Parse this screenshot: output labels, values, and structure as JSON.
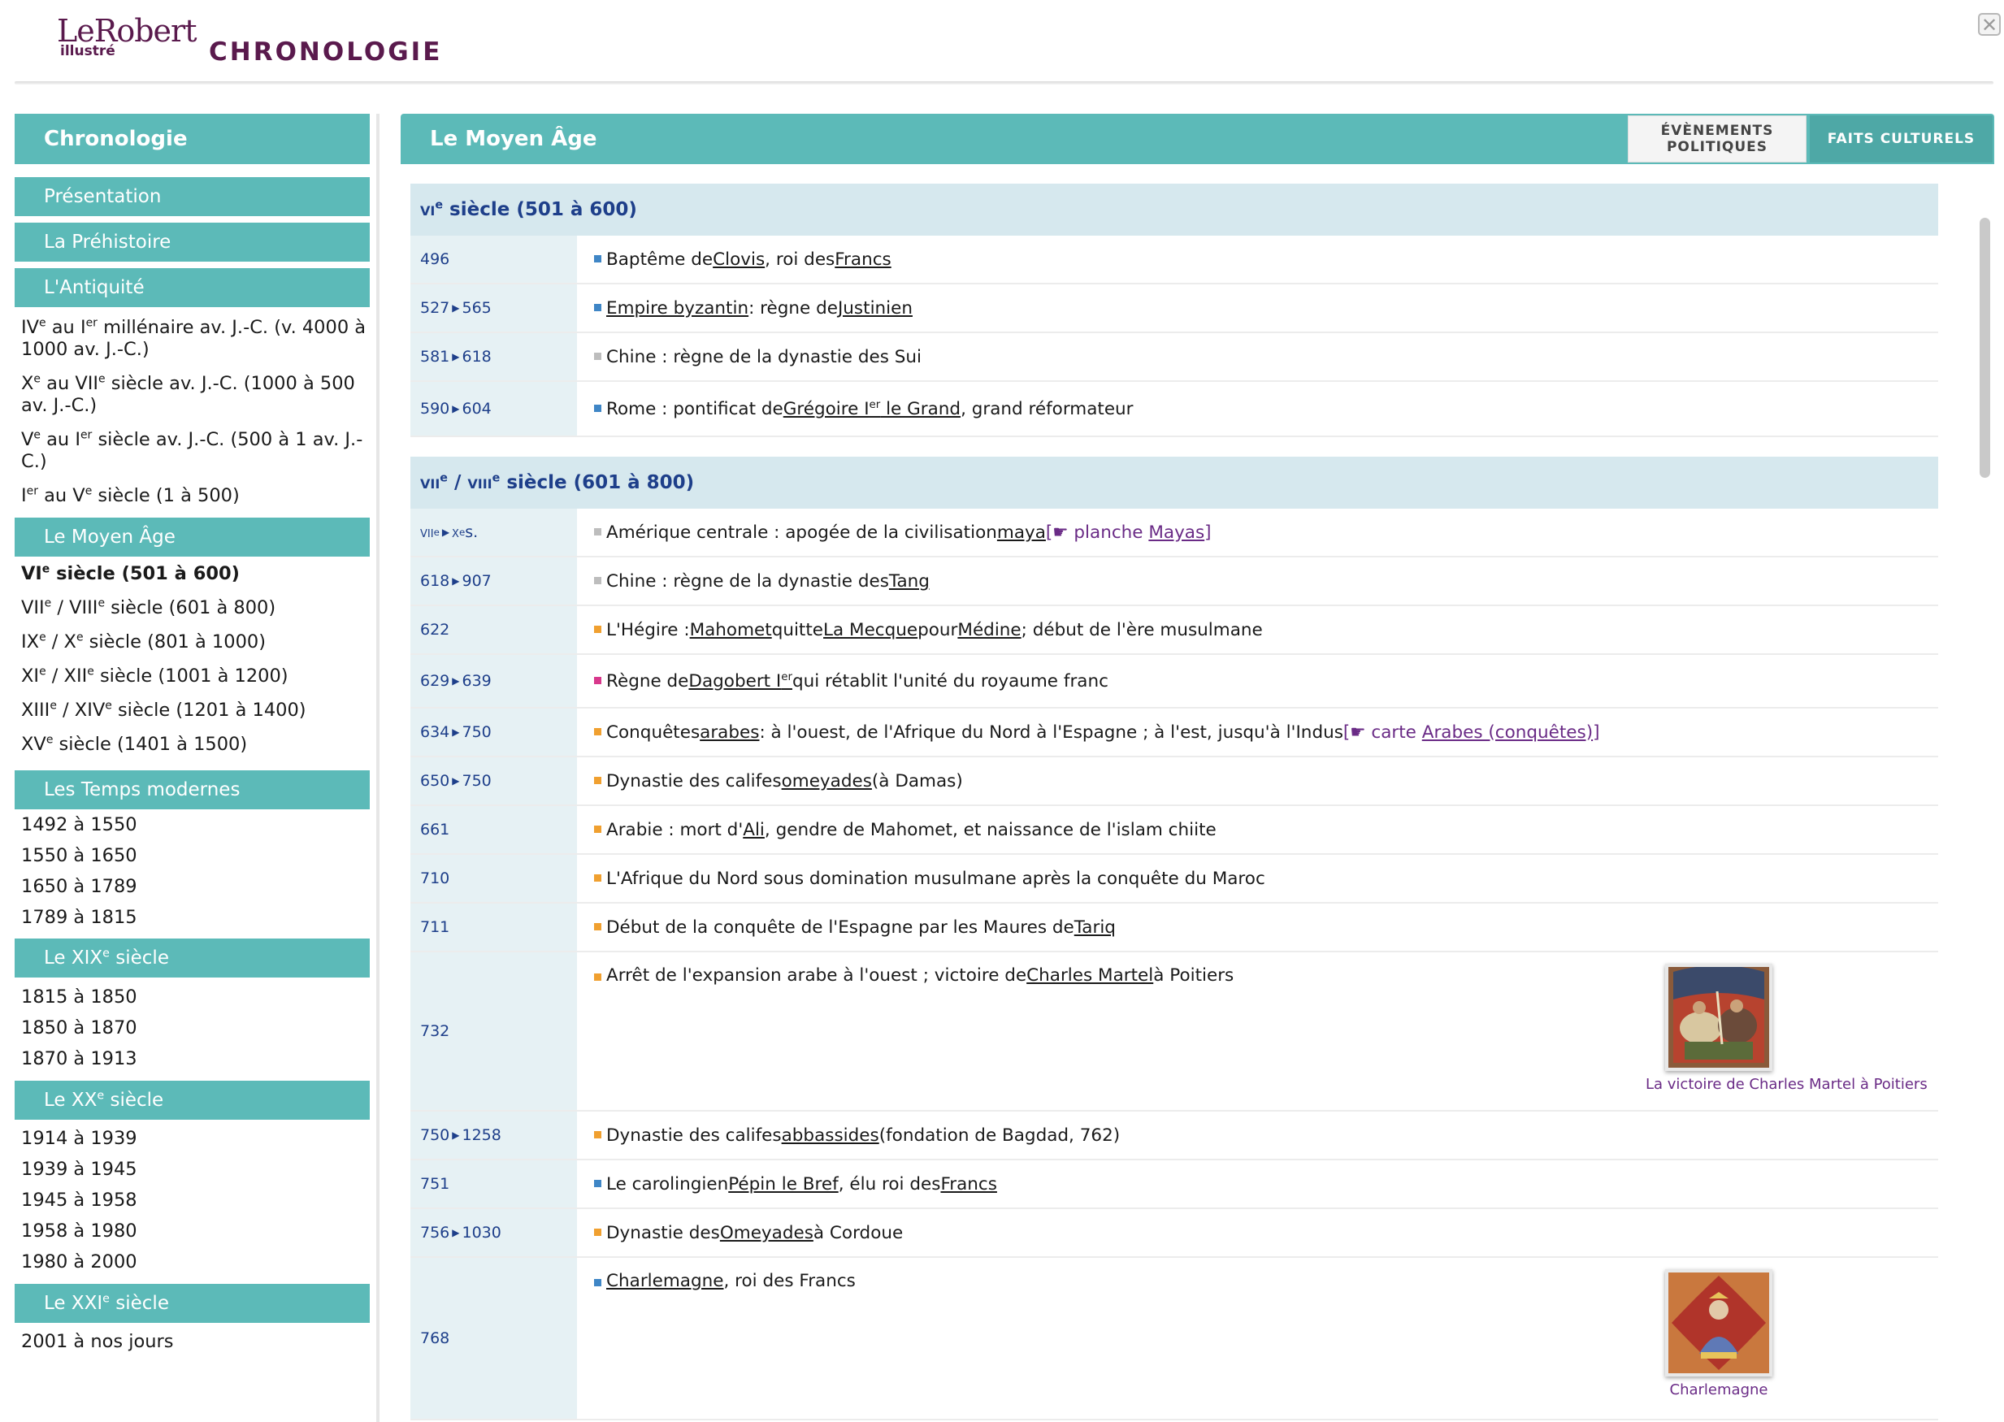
{
  "header": {
    "logo_main": "LeRobert",
    "logo_sub": "illustré",
    "app_title": "CHRONOLOGIE",
    "close_label": "✕"
  },
  "sidebar": {
    "title": "Chronologie",
    "items": {
      "presentation": "Présentation",
      "prehistoire": "La Préhistoire",
      "antiquite": "L'Antiquité",
      "ant1_a": "IV",
      "ant1_b": "e",
      "ant1_c": " au I",
      "ant1_d": "er",
      "ant1_e": " millénaire av. J.-C. (v. 4000 à 1000 av. J.-C.)",
      "ant2_a": "X",
      "ant2_b": "e",
      "ant2_c": " au VII",
      "ant2_d": "e",
      "ant2_e": " siècle av. J.-C. (1000 à 500 av. J.-C.)",
      "ant3_a": "V",
      "ant3_b": "e",
      "ant3_c": " au I",
      "ant3_d": "er",
      "ant3_e": " siècle av. J.-C. (500 à 1 av. J.-C.)",
      "ant4_a": "I",
      "ant4_b": "er",
      "ant4_c": " au V",
      "ant4_d": "e",
      "ant4_e": " siècle (1 à 500)",
      "moyen_age": "Le Moyen Âge",
      "ma1_a": "VI",
      "ma1_b": "e",
      "ma1_c": " siècle (501 à 600)",
      "ma2_a": "VII",
      "ma2_b": "e",
      "ma2_c": " / VIII",
      "ma2_d": "e",
      "ma2_e": " siècle (601 à 800)",
      "ma3_a": "IX",
      "ma3_b": "e",
      "ma3_c": " / X",
      "ma3_d": "e",
      "ma3_e": " siècle (801 à 1000)",
      "ma4_a": "XI",
      "ma4_b": "e",
      "ma4_c": " / XII",
      "ma4_d": "e",
      "ma4_e": " siècle (1001 à 1200)",
      "ma5_a": "XIII",
      "ma5_b": "e",
      "ma5_c": " / XIV",
      "ma5_d": "e",
      "ma5_e": " siècle (1201 à 1400)",
      "ma6_a": "XV",
      "ma6_b": "e",
      "ma6_c": " siècle (1401 à 1500)",
      "temps_modernes": "Les Temps modernes",
      "tm1": "1492 à 1550",
      "tm2": "1550 à 1650",
      "tm3": "1650 à 1789",
      "tm4": "1789 à 1815",
      "xix_a": "Le XIX",
      "xix_b": "e",
      "xix_c": " siècle",
      "x19_1": "1815 à 1850",
      "x19_2": "1850 à 1870",
      "x19_3": "1870 à 1913",
      "xx_a": "Le XX",
      "xx_b": "e",
      "xx_c": " siècle",
      "x20_1": "1914 à 1939",
      "x20_2": "1939 à 1945",
      "x20_3": "1945 à 1958",
      "x20_4": "1958 à 1980",
      "x20_5": "1980 à 2000",
      "xxi_a": "Le XXI",
      "xxi_b": "e",
      "xxi_c": " siècle",
      "x21_1": "2001 à nos jours"
    }
  },
  "main": {
    "title": "Le Moyen Âge",
    "tab_political": "Évènements politiques",
    "tab_cultural": "Faits culturels",
    "sec1": {
      "a": "vi",
      "b": "e",
      "c": " siècle (501 à 600)"
    },
    "sec2": {
      "a": "vii",
      "b": "e",
      "c": " / ",
      "d": "viii",
      "e": "e",
      "f": " siècle (601 à 800)"
    },
    "arrow": "▶",
    "rows": {
      "r1": {
        "date": "496",
        "t1": "Baptême de ",
        "l1": "Clovis",
        "t2": ", roi des ",
        "l2": "Francs"
      },
      "r2": {
        "d1": "527",
        "d2": "565",
        "l1": "Empire byzantin",
        "t1": " : règne de ",
        "l2": "Justinien"
      },
      "r3": {
        "d1": "581",
        "d2": "618",
        "t1": "Chine : règne de la dynastie des Sui"
      },
      "r4": {
        "d1": "590",
        "d2": "604",
        "t1": "Rome : pontificat de ",
        "l1a": "Grégoire I",
        "l1b": "er",
        "l1c": " le Grand",
        "t2": ", grand réformateur"
      },
      "r5": {
        "d1a": "vii",
        "d1b": "e",
        "d2a": "x",
        "d2b": "e",
        "d2c": " s.",
        "t1": "Amérique centrale : apogée de la civilisation ",
        "l1": "maya",
        "t2": " ",
        "ref1": "[☛ planche ",
        "ref2": "Mayas",
        "ref3": "]"
      },
      "r6": {
        "d1": "618",
        "d2": "907",
        "t1": "Chine : règne de la dynastie des ",
        "l1": "Tang"
      },
      "r7": {
        "date": "622",
        "t1": "L'Hégire : ",
        "l1": "Mahomet",
        "t2": " quitte ",
        "l2": "La Mecque",
        "t3": " pour ",
        "l3": "Médine",
        "t4": " ; début de l'ère musulmane"
      },
      "r8": {
        "d1": "629",
        "d2": "639",
        "t1": "Règne de ",
        "l1a": "Dagobert I",
        "l1b": "er",
        "t2": " qui rétablit l'unité du royaume franc"
      },
      "r9": {
        "d1": "634",
        "d2": "750",
        "t1": "Conquêtes ",
        "l1": "arabes",
        "t2": " : à l'ouest, de l'Afrique du Nord à l'Espagne ; à l'est, jusqu'à l'Indus ",
        "ref1": "[☛ carte ",
        "ref2": "Arabes (conquêtes)",
        "ref3": "]"
      },
      "r10": {
        "d1": "650",
        "d2": "750",
        "t1": "Dynastie des califes ",
        "l1": "omeyades",
        "t2": " (à Damas)"
      },
      "r11": {
        "date": "661",
        "t1": "Arabie : mort d'",
        "l1": "Ali",
        "t2": ", gendre de Mahomet, et naissance de l'islam chiite"
      },
      "r12": {
        "date": "710",
        "t1": "L'Afrique du Nord sous domination musulmane après la conquête du Maroc"
      },
      "r13": {
        "date": "711",
        "t1": "Début de la conquête de l'Espagne par les Maures de ",
        "l1": "Tariq"
      },
      "r14": {
        "date": "732",
        "t1": "Arrêt de l'expansion arabe à l'ouest ; victoire de ",
        "l1": "Charles Martel",
        "t2": " à Poitiers",
        "caption": "La victoire de Charles Martel à Poitiers"
      },
      "r15": {
        "d1": "750",
        "d2": "1258",
        "t1": "Dynastie des califes ",
        "l1": "abbassides",
        "t2": " (fondation de Bagdad, 762)"
      },
      "r16": {
        "date": "751",
        "t1": "Le carolingien ",
        "l1": "Pépin le Bref",
        "t2": ", élu roi des ",
        "l2": "Francs"
      },
      "r17": {
        "d1": "756",
        "d2": "1030",
        "t1": "Dynastie des ",
        "l1": "Omeyades",
        "t2": " à Cordoue"
      },
      "r18": {
        "date": "768",
        "l1": "Charlemagne",
        "t1": ", roi des Francs",
        "caption": "Charlemagne"
      }
    }
  },
  "colors": {
    "teal": "#5cbab8",
    "brand": "#5a1a4d",
    "date_blue": "#1e3f8a",
    "bullet_blue": "#3f86c6",
    "bullet_grey": "#bdbdbd",
    "bullet_orange": "#f0a030",
    "bullet_pink": "#d8388c",
    "link_purple": "#6a2b86"
  }
}
